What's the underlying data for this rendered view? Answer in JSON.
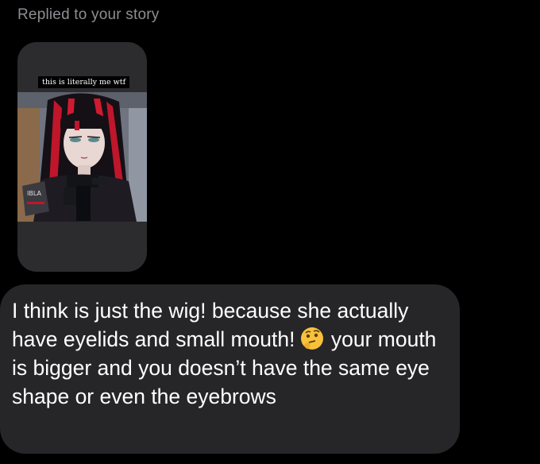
{
  "header": {
    "reply_label": "Replied to your story"
  },
  "story": {
    "caption": "this is literally me wtf",
    "image_description_icon": "anime-character-image"
  },
  "message": {
    "text_part1": "I think is just the wig! because she actually have eyelids and small mouth!",
    "emoji": "thinking-face",
    "text_part2": "your mouth is bigger and you doesn’t have the same eye shape or even the eyebrows"
  },
  "colors": {
    "background": "#000000",
    "bubble": "#262628",
    "story_card": "#2c2c2e",
    "secondary_text": "#8e8e93",
    "primary_text": "#ffffff"
  }
}
